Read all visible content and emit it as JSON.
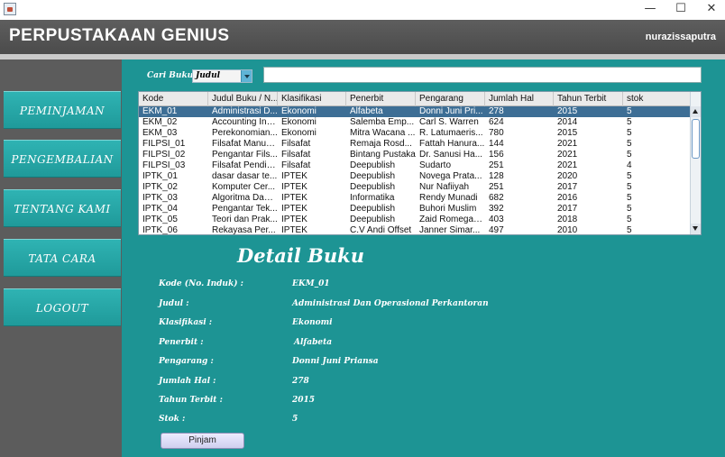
{
  "window": {
    "minimize_glyph": "—",
    "maximize_glyph": "☐",
    "close_glyph": "✕"
  },
  "header": {
    "title": "PERPUSTAKAAN GENIUS",
    "username": "nurazissaputra"
  },
  "sidebar": {
    "items": [
      {
        "label": "PEMINJAMAN"
      },
      {
        "label": "PENGEMBALIAN"
      },
      {
        "label": "TENTANG KAMI"
      },
      {
        "label": "TATA CARA"
      },
      {
        "label": "LOGOUT"
      }
    ]
  },
  "search": {
    "label": "Cari Buku",
    "selected_option": "Judul",
    "input_value": "",
    "input_placeholder": ""
  },
  "table": {
    "columns": [
      "Kode",
      "Judul Buku / N...",
      "Klasifikasi",
      "Penerbit",
      "Pengarang",
      "Jumlah Hal",
      "Tahun Terbit",
      "stok"
    ],
    "rows": [
      [
        "EKM_01",
        "Administrasi D...",
        "Ekonomi",
        "Alfabeta",
        "Donni Juni Pri...",
        "278",
        "2015",
        "5"
      ],
      [
        "EKM_02",
        "Accounting Ind...",
        "Ekonomi",
        "Salemba Emp...",
        "Carl S. Warren",
        "624",
        "2014",
        "5"
      ],
      [
        "EKM_03",
        "Perekonomian...",
        "Ekonomi",
        "Mitra Wacana ...",
        "R. Latumaeris...",
        "780",
        "2015",
        "5"
      ],
      [
        "FILPSI_01",
        "Filsafat Manus...",
        "Filsafat",
        "Remaja Rosd...",
        "Fattah Hanura...",
        "144",
        "2021",
        "5"
      ],
      [
        "FILPSI_02",
        "Pengantar Fils...",
        "Filsafat",
        "Bintang Pustaka",
        "Dr. Sanusi Ha...",
        "156",
        "2021",
        "5"
      ],
      [
        "FILPSI_03",
        "Filsafat Pendid...",
        "Filsafat",
        "Deepublish",
        "Sudarto",
        "251",
        "2021",
        "4"
      ],
      [
        "IPTK_01",
        "dasar dasar te...",
        "IPTEK",
        "Deepublish",
        "Novega Prata...",
        "128",
        "2020",
        "5"
      ],
      [
        "IPTK_02",
        "Komputer Cer...",
        "IPTEK",
        "Deepublish",
        "Nur Nafiiyah",
        "251",
        "2017",
        "5"
      ],
      [
        "IPTK_03",
        "Algoritma Dan ...",
        "IPTEK",
        "Informatika",
        "Rendy Munadi",
        "682",
        "2016",
        "5"
      ],
      [
        "IPTK_04",
        "Pengantar Tek...",
        "IPTEK",
        "Deepublish",
        "Buhori Muslim",
        "392",
        "2017",
        "5"
      ],
      [
        "IPTK_05",
        "Teori dan Prak...",
        "IPTEK",
        "Deepublish",
        "Zaid Romegar ...",
        "403",
        "2018",
        "5"
      ],
      [
        "IPTK_06",
        "Rekayasa Per...",
        "IPTEK",
        "C.V Andi Offset",
        "Janner Simar...",
        "497",
        "2010",
        "5"
      ]
    ],
    "selected_row": 0
  },
  "detail": {
    "title": "Detail Buku",
    "fields": [
      {
        "label": "Kode (No. Induk) :",
        "value": "EKM_01"
      },
      {
        "label": "Judul :",
        "value": "Administrasi Dan Operasional Perkantoran"
      },
      {
        "label": "Klasifikasi :",
        "value": "Ekonomi"
      },
      {
        "label": "Penerbit :",
        "value": "Alfabeta"
      },
      {
        "label": "Pengarang :",
        "value": "Donni Juni Priansa"
      },
      {
        "label": "Jumlah Hal :",
        "value": "278"
      },
      {
        "label": "Tahun Terbit :",
        "value": "2015"
      },
      {
        "label": "Stok :",
        "value": "5"
      }
    ],
    "button_label": "Pinjam"
  }
}
